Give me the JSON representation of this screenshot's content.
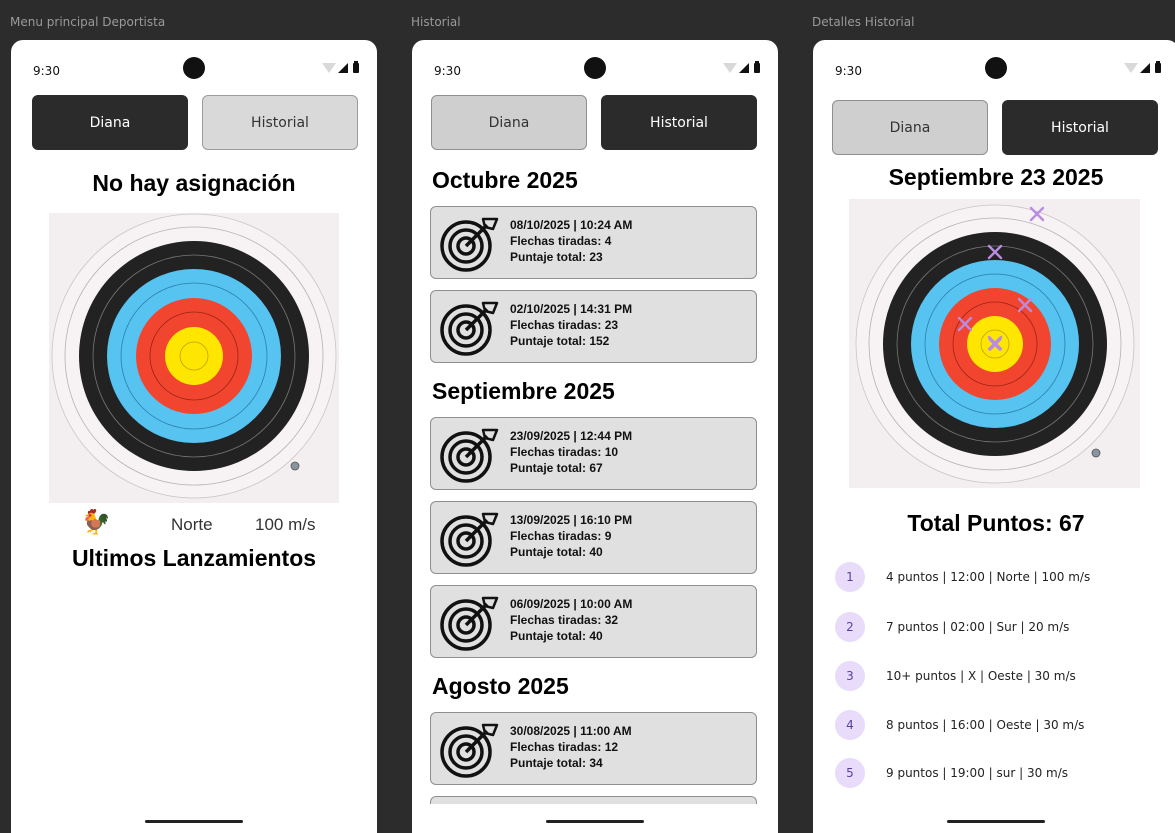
{
  "frames": {
    "menu_label": "Menu principal Deportista",
    "history_label": "Historial",
    "details_label": "Detalles Historial"
  },
  "status": {
    "time": "9:30"
  },
  "tabs": {
    "diana": "Diana",
    "historial": "Historial"
  },
  "menu": {
    "title": "No hay asignación",
    "wind_direction": "Norte",
    "wind_speed": "100 m/s",
    "subtitle": "Ultimos Lanzamientos"
  },
  "history": {
    "months": [
      {
        "name": "Octubre 2025",
        "sessions": [
          {
            "datetime": "08/10/2025 | 10:24 AM",
            "arrows": "Flechas tiradas: 4",
            "score": "Puntaje total: 23"
          },
          {
            "datetime": "02/10/2025 | 14:31 PM",
            "arrows": "Flechas tiradas: 23",
            "score": "Puntaje total: 152"
          }
        ]
      },
      {
        "name": "Septiembre 2025",
        "sessions": [
          {
            "datetime": "23/09/2025 | 12:44 PM",
            "arrows": "Flechas tiradas: 10",
            "score": "Puntaje total: 67"
          },
          {
            "datetime": "13/09/2025 | 16:10 PM",
            "arrows": "Flechas tiradas: 9",
            "score": "Puntaje total: 40"
          },
          {
            "datetime": "06/09/2025 | 10:00 AM",
            "arrows": "Flechas tiradas: 32",
            "score": "Puntaje total: 40"
          }
        ]
      },
      {
        "name": "Agosto 2025",
        "sessions": [
          {
            "datetime": "30/08/2025 | 11:00 AM",
            "arrows": "Flechas tiradas: 12",
            "score": "Puntaje total: 34"
          }
        ]
      }
    ]
  },
  "details": {
    "title": "Septiembre 23 2025",
    "total": "Total Puntos: 67",
    "shots": [
      {
        "n": "1",
        "text": "4 puntos | 12:00 | Norte | 100 m/s"
      },
      {
        "n": "2",
        "text": "7 puntos | 02:00 | Sur | 20 m/s"
      },
      {
        "n": "3",
        "text": "10+ puntos | X | Oeste | 30 m/s"
      },
      {
        "n": "4",
        "text": "8 puntos | 16:00 | Oeste | 30 m/s"
      },
      {
        "n": "5",
        "text": "9 puntos | 19:00 | sur | 30 m/s"
      }
    ]
  },
  "colors": {
    "dark_button": "#2b2b2b",
    "light_button": "#d9d9d9",
    "card_bg": "#e0e0e0",
    "target_black": "#222222",
    "target_blue": "#56c3f1",
    "target_red": "#f2452f",
    "target_yellow": "#ffe600",
    "hit_marker": "#b98ce0",
    "shot_badge": "#e8dcfa"
  },
  "icons": {
    "target_card": "bullseye-arrow-icon",
    "wind": "rooster-weathervane-icon"
  }
}
